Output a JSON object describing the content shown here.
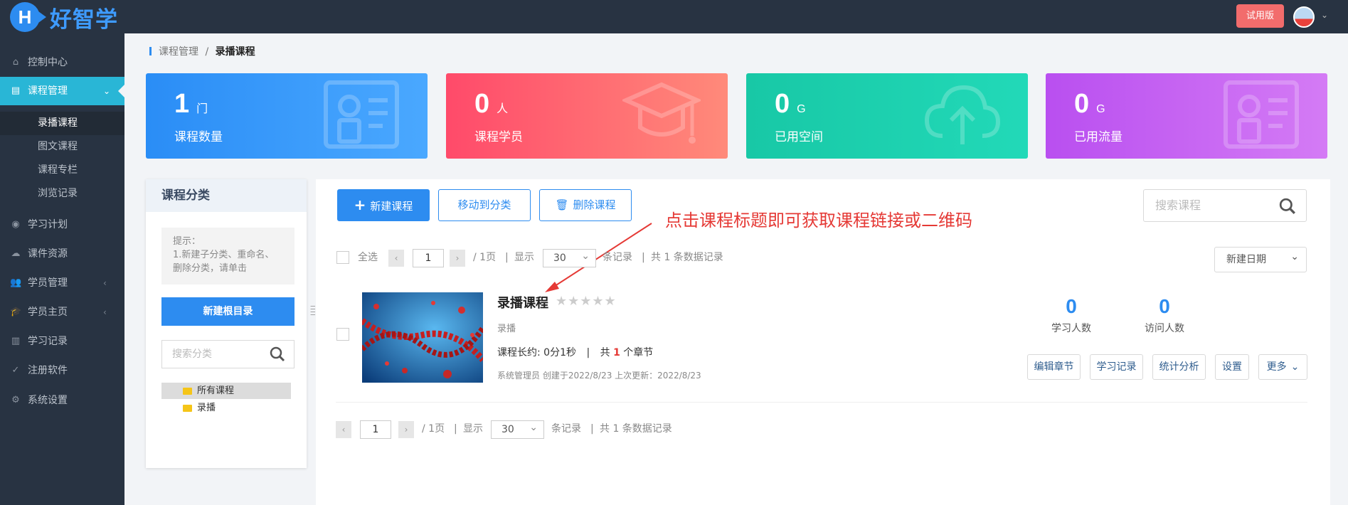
{
  "app": {
    "logo_letter": "H",
    "name": "好智学",
    "trial_label": "试用版"
  },
  "sidebar": {
    "items": [
      {
        "label": "控制中心",
        "icon": "home-icon"
      },
      {
        "label": "课程管理",
        "icon": "book-icon",
        "active": true
      },
      {
        "label": "学习计划",
        "icon": "eye-icon"
      },
      {
        "label": "课件资源",
        "icon": "cloud-icon"
      },
      {
        "label": "学员管理",
        "icon": "users-icon"
      },
      {
        "label": "学员主页",
        "icon": "graduation-cap-icon"
      },
      {
        "label": "学习记录",
        "icon": "notebook-icon"
      },
      {
        "label": "注册软件",
        "icon": "check-circle-icon"
      },
      {
        "label": "系统设置",
        "icon": "gear-icon"
      }
    ],
    "sub_items": [
      "录播课程",
      "图文课程",
      "课程专栏",
      "浏览记录"
    ]
  },
  "breadcrumb": {
    "parent": "课程管理",
    "sep": "/",
    "current": "录播课程"
  },
  "stats": [
    {
      "value": "1",
      "unit": "门",
      "label": "课程数量",
      "color_from": "#2a8df6",
      "color_to": "#4aa8ff"
    },
    {
      "value": "0",
      "unit": "人",
      "label": "课程学员",
      "color_from": "#ff4a6a",
      "color_to": "#ff8a7a"
    },
    {
      "value": "0",
      "unit": "G",
      "label": "已用空间",
      "color_from": "#18c8a6",
      "color_to": "#22d9b8"
    },
    {
      "value": "0",
      "unit": "G",
      "label": "已用流量",
      "color_from": "#b94ff0",
      "color_to": "#d47bf5"
    }
  ],
  "category": {
    "title": "课程分类",
    "tip": "提示：\n1.新建子分类、重命名、删除分类，请单击",
    "new_root_label": "新建根目录",
    "search_placeholder": "搜索分类",
    "tree": [
      "所有课程",
      "录播"
    ]
  },
  "toolbar": {
    "new_course": "新建课程",
    "move_to_category": "移动到分类",
    "delete_course": "删除课程",
    "search_placeholder": "搜索课程"
  },
  "annotation": "点击课程标题即可获取课程链接或二维码",
  "pager": {
    "select_all": "全选",
    "page": "1",
    "total_pages": "/ 1页",
    "sep": "|",
    "show": "显示",
    "page_size": "30",
    "per_page_suffix": "条记录",
    "total": "共 1 条数据记录"
  },
  "sort": {
    "selected": "新建日期"
  },
  "course": {
    "title": "录播课程",
    "type": "录播",
    "duration_label": "课程长约:",
    "duration": "0分1秒",
    "meta_sep": "|",
    "chapters_prefix": "共",
    "chapters": "1",
    "chapters_suffix": "个章节",
    "info": "系统管理员 创建于2022/8/23 上次更新：2022/8/23",
    "learners_count": "0",
    "learners_label": "学习人数",
    "visitors_count": "0",
    "visitors_label": "访问人数",
    "actions": [
      "编辑章节",
      "学习记录",
      "统计分析",
      "设置",
      "更多"
    ]
  }
}
